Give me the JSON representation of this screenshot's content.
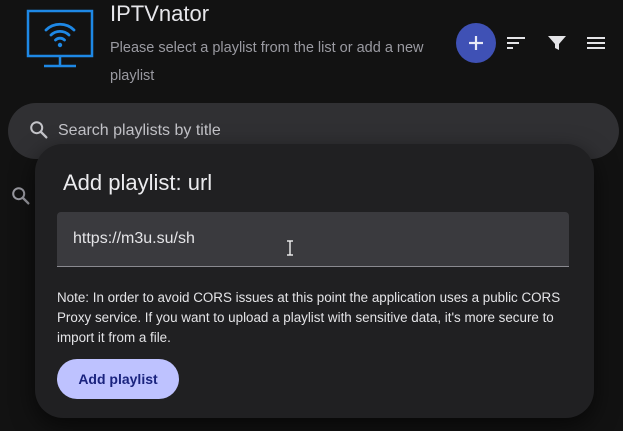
{
  "header": {
    "title": "IPTVnator",
    "subtitle": "Please select a playlist from the list or add a new playlist",
    "logo_icon": "tv-wifi-icon",
    "actions": [
      {
        "name": "add-playlist-fab",
        "icon": "plus-icon"
      },
      {
        "name": "sort-button",
        "icon": "sort-icon"
      },
      {
        "name": "filter-button",
        "icon": "filter-icon"
      },
      {
        "name": "menu-button",
        "icon": "menu-icon"
      }
    ]
  },
  "search": {
    "placeholder": "Search playlists by title",
    "value": ""
  },
  "dialog": {
    "title": "Add playlist: url",
    "url_value": "https://m3u.su/sh",
    "note": "Note: In order to avoid CORS issues at this point the application uses a public CORS Proxy service. If you want to upload a playlist with sensitive data, it's more secure to import it from a file.",
    "submit_label": "Add playlist"
  },
  "colors": {
    "background": "#121212",
    "fab": "#3f51b5",
    "logo": "#1e88e5",
    "dialog_bg": "#202022",
    "button_bg": "#bec2ff",
    "button_text": "#1a237e"
  }
}
